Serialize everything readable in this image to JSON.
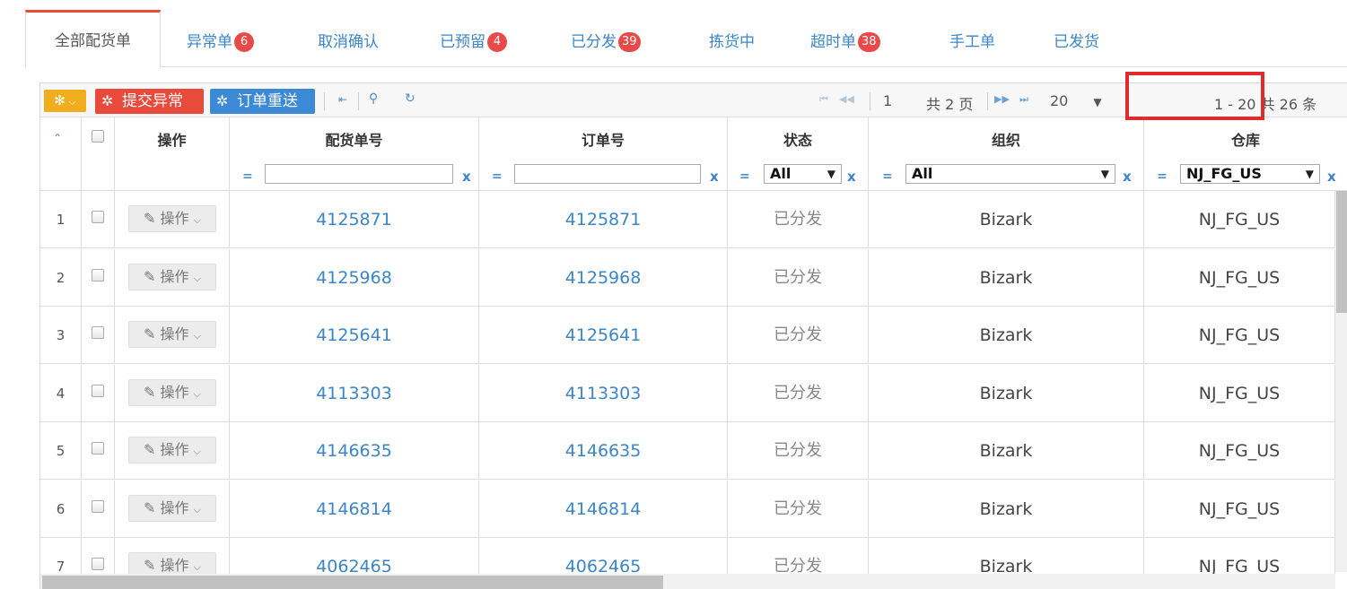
{
  "tabs": {
    "active": "全部配货单",
    "items": [
      {
        "label": "异常单",
        "badge": "6"
      },
      {
        "label": "取消确认",
        "badge": ""
      },
      {
        "label": "已预留",
        "badge": "4"
      },
      {
        "label": "已分发",
        "badge": "39"
      },
      {
        "label": "拣货中",
        "badge": ""
      },
      {
        "label": "超时单",
        "badge": "38"
      },
      {
        "label": "手工单",
        "badge": ""
      },
      {
        "label": "已发货",
        "badge": ""
      }
    ]
  },
  "toolbar": {
    "submit_exception_label": "提交异常",
    "resend_order_label": "订单重送",
    "page_current": "1",
    "page_total_label": "共 2 页",
    "page_size": "20",
    "record_range": "1 - 20  共 26 条"
  },
  "columns": {
    "action": "操作",
    "allocation_no": "配货单号",
    "order_no": "订单号",
    "status": "状态",
    "organization": "组织",
    "warehouse": "仓库"
  },
  "filters": {
    "eq": "=",
    "clear": "x",
    "status_value": "All",
    "organization_value": "All",
    "warehouse_value": "NJ_FG_US"
  },
  "op_button_label": "操作",
  "rows": [
    {
      "num": "1",
      "allocation_no": "4125871",
      "order_no": "4125871",
      "status": "已分发",
      "organization": "Bizark",
      "warehouse": "NJ_FG_US"
    },
    {
      "num": "2",
      "allocation_no": "4125968",
      "order_no": "4125968",
      "status": "已分发",
      "organization": "Bizark",
      "warehouse": "NJ_FG_US"
    },
    {
      "num": "3",
      "allocation_no": "4125641",
      "order_no": "4125641",
      "status": "已分发",
      "organization": "Bizark",
      "warehouse": "NJ_FG_US"
    },
    {
      "num": "4",
      "allocation_no": "4113303",
      "order_no": "4113303",
      "status": "已分发",
      "organization": "Bizark",
      "warehouse": "NJ_FG_US"
    },
    {
      "num": "5",
      "allocation_no": "4146635",
      "order_no": "4146635",
      "status": "已分发",
      "organization": "Bizark",
      "warehouse": "NJ_FG_US"
    },
    {
      "num": "6",
      "allocation_no": "4146814",
      "order_no": "4146814",
      "status": "已分发",
      "organization": "Bizark",
      "warehouse": "NJ_FG_US"
    },
    {
      "num": "7",
      "allocation_no": "4062465",
      "order_no": "4062465",
      "status": "已分发",
      "organization": "Bizark",
      "warehouse": "NJ_FG_US"
    }
  ],
  "colors": {
    "accent_red": "#e84a3c",
    "link_blue": "#3c85c6",
    "gear_orange": "#f0ad1e"
  }
}
